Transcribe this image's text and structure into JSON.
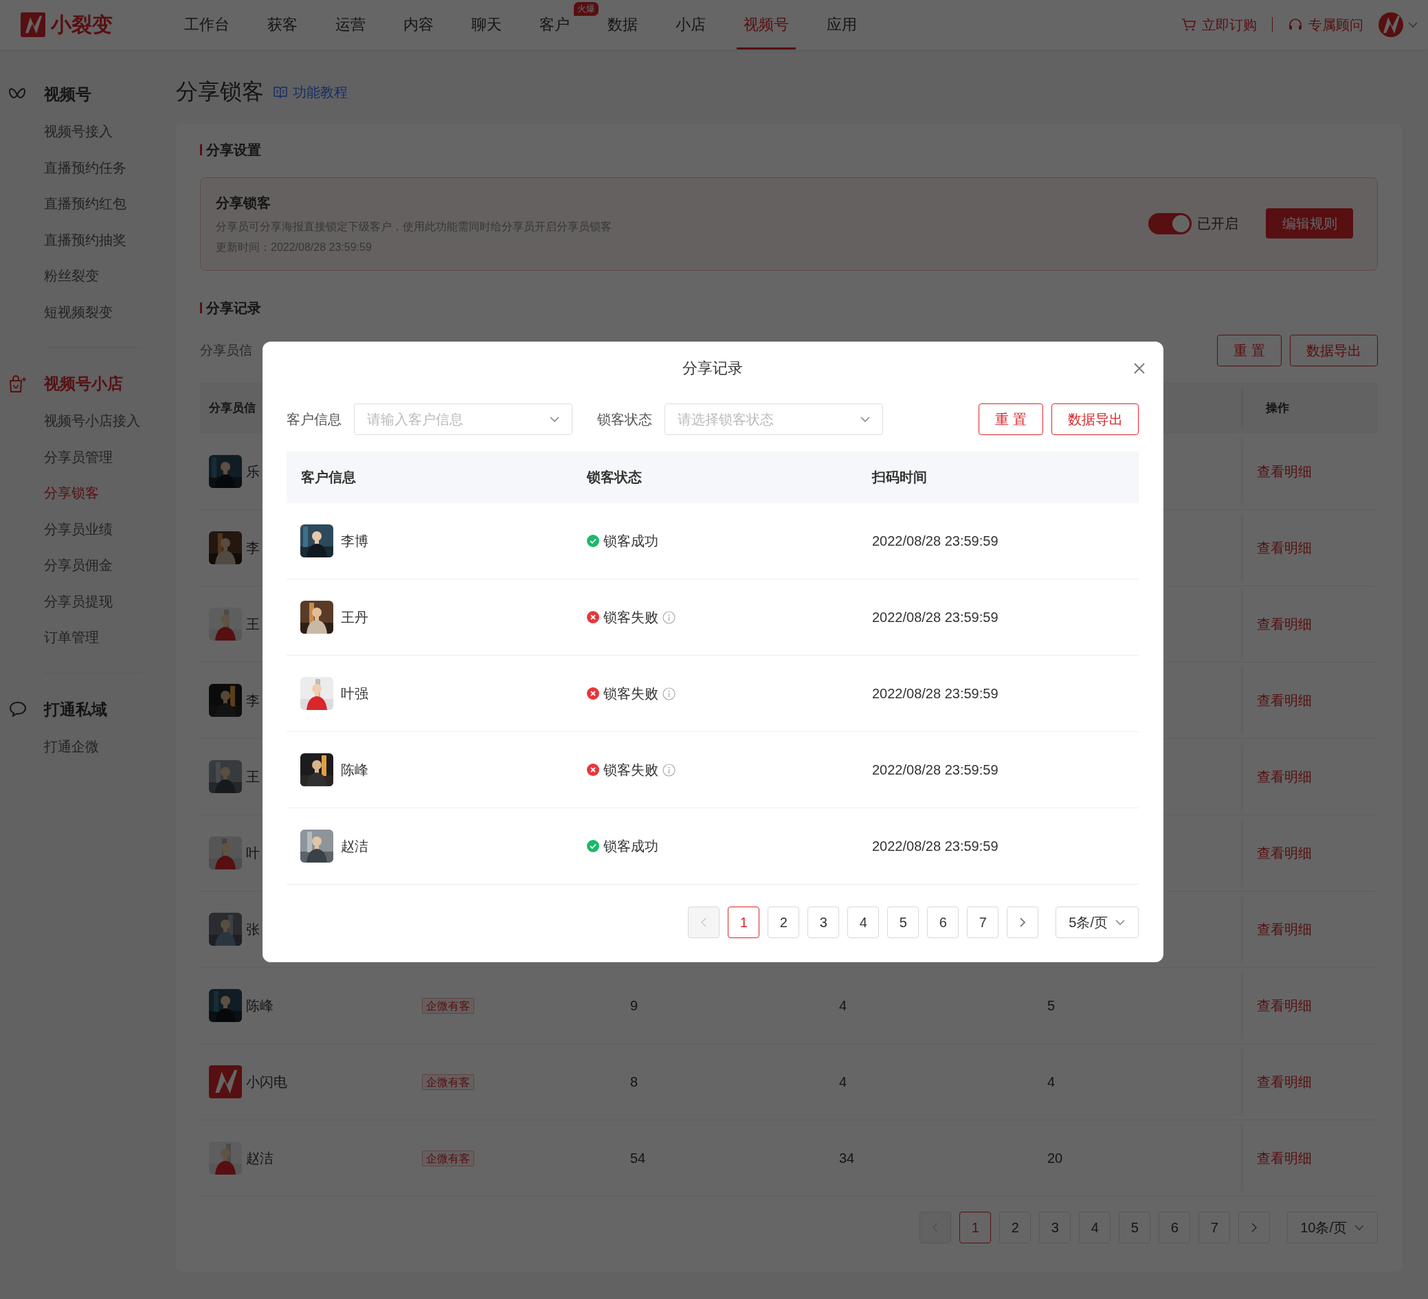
{
  "top_nav": {
    "brand": "小裂变",
    "items": [
      {
        "label": "工作台",
        "selected": false
      },
      {
        "label": "获客",
        "selected": false
      },
      {
        "label": "运营",
        "selected": false
      },
      {
        "label": "内容",
        "selected": false
      },
      {
        "label": "聊天",
        "selected": false
      },
      {
        "label": "客户",
        "selected": false,
        "badge": "火爆"
      },
      {
        "label": "数据",
        "selected": false
      },
      {
        "label": "小店",
        "selected": false
      },
      {
        "label": "视频号",
        "selected": true
      },
      {
        "label": "应用",
        "selected": false
      }
    ],
    "order_link": "立即订购",
    "advisor_link": "专属顾问"
  },
  "sidebar": {
    "groups": [
      {
        "title": "视频号",
        "active": false,
        "items": [
          {
            "label": "视频号接入",
            "selected": false
          },
          {
            "label": "直播预约任务",
            "selected": false
          },
          {
            "label": "直播预约红包",
            "selected": false
          },
          {
            "label": "直播预约抽奖",
            "selected": false
          },
          {
            "label": "粉丝裂变",
            "selected": false
          },
          {
            "label": "短视频裂变",
            "selected": false
          }
        ]
      },
      {
        "title": "视频号小店",
        "active": true,
        "items": [
          {
            "label": "视频号小店接入",
            "selected": false
          },
          {
            "label": "分享员管理",
            "selected": false
          },
          {
            "label": "分享锁客",
            "selected": true
          },
          {
            "label": "分享员业绩",
            "selected": false
          },
          {
            "label": "分享员佣金",
            "selected": false
          },
          {
            "label": "分享员提现",
            "selected": false
          },
          {
            "label": "订单管理",
            "selected": false
          }
        ]
      },
      {
        "title": "打通私域",
        "active": false,
        "items": [
          {
            "label": "打通企微",
            "selected": false
          }
        ]
      }
    ]
  },
  "page": {
    "title": "分享锁客",
    "tutorial_link": "功能教程"
  },
  "settings": {
    "heading": "分享设置",
    "title": "分享锁客",
    "description": "分享员可分享海报直接锁定下级客户，使用此功能需同时给分享员开启分享员锁客",
    "updated": "更新时间：2022/08/28 23:59:59",
    "toggle": {
      "on": true,
      "label": "已开启"
    },
    "edit_button": "编辑规则"
  },
  "records": {
    "heading": "分享记录",
    "filter_label": "分享员信",
    "buttons": [
      "重 置",
      "数据导出"
    ],
    "columns": [
      "分享员信",
      "操作"
    ],
    "rows": [
      {
        "name": "乐",
        "action": "查看明细"
      },
      {
        "name": "李",
        "action": "查看明细"
      },
      {
        "name": "王",
        "action": "查看明细"
      },
      {
        "name": "李",
        "action": "查看明细"
      },
      {
        "name": "王",
        "action": "查看明细"
      },
      {
        "name": "叶",
        "action": "查看明细"
      },
      {
        "name": "张",
        "action": "查看明细"
      },
      {
        "name": "陈峰",
        "tag": "企微有客",
        "values": [
          "9",
          "4",
          "5"
        ],
        "action": "查看明细"
      },
      {
        "avatar": {
          "kind": "logo"
        },
        "name": "小闪电",
        "tag": "企微有客",
        "values": [
          "8",
          "4",
          "4"
        ],
        "action": "查看明细"
      },
      {
        "name": "赵洁",
        "tag": "企微有客",
        "values": [
          "54",
          "34",
          "20"
        ],
        "action": "查看明细"
      }
    ],
    "pagination": {
      "prev": {
        "disabled": true
      },
      "next": {
        "disabled": false
      },
      "pages": [
        {
          "label": "1",
          "selected": true
        },
        {
          "label": "2",
          "selected": false
        },
        {
          "label": "3",
          "selected": false
        },
        {
          "label": "4",
          "selected": false
        },
        {
          "label": "5",
          "selected": false
        },
        {
          "label": "6",
          "selected": false
        },
        {
          "label": "7",
          "selected": false
        }
      ],
      "page_size": "10条/页"
    }
  },
  "modal": {
    "title": "分享记录",
    "filters": [
      {
        "label": "客户信息",
        "placeholder": "请输入客户信息"
      },
      {
        "label": "锁客状态",
        "placeholder": "请选择锁客状态"
      }
    ],
    "buttons": [
      "重 置",
      "数据导出"
    ],
    "columns": [
      "客户信息",
      "锁客状态",
      "扫码时间"
    ],
    "rows": [
      {
        "name": "李博",
        "status": {
          "ok": true,
          "text": "锁客成功"
        },
        "time": "2022/08/28 23:59:59"
      },
      {
        "name": "王丹",
        "status": {
          "ok": false,
          "text": "锁客失败"
        },
        "time": "2022/08/28 23:59:59"
      },
      {
        "name": "叶强",
        "status": {
          "ok": false,
          "text": "锁客失败"
        },
        "time": "2022/08/28 23:59:59"
      },
      {
        "name": "陈峰",
        "status": {
          "ok": false,
          "text": "锁客失败"
        },
        "time": "2022/08/28 23:59:59"
      },
      {
        "name": "赵洁",
        "status": {
          "ok": true,
          "text": "锁客成功"
        },
        "time": "2022/08/28 23:59:59"
      }
    ],
    "pagination": {
      "prev": {
        "disabled": true
      },
      "next": {
        "disabled": false
      },
      "pages": [
        {
          "label": "1",
          "selected": true
        },
        {
          "label": "2",
          "selected": false
        },
        {
          "label": "3",
          "selected": false
        },
        {
          "label": "4",
          "selected": false
        },
        {
          "label": "5",
          "selected": false
        },
        {
          "label": "6",
          "selected": false
        },
        {
          "label": "7",
          "selected": false
        }
      ],
      "page_size": "5条/页"
    }
  }
}
